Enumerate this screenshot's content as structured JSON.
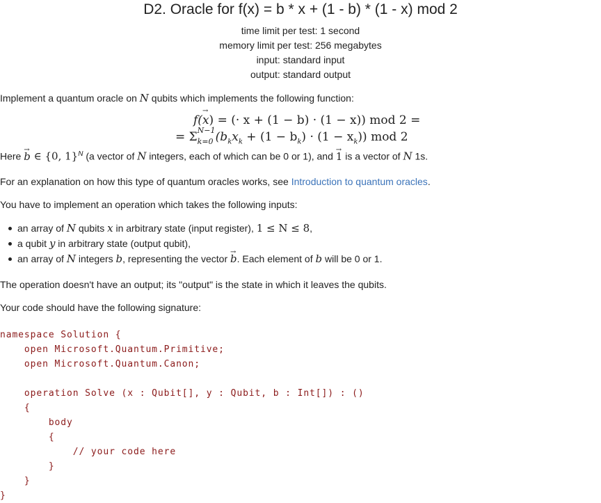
{
  "header": {
    "title": "D2. Oracle for f(x) = b * x + (1 - b) * (1 - x) mod 2",
    "time_limit": "time limit per test: 1 second",
    "memory_limit": "memory limit per test: 256 megabytes",
    "input": "input: standard input",
    "output": "output: standard output"
  },
  "statement": {
    "intro_before": "Implement a quantum oracle on ",
    "intro_N": "N",
    "intro_after": " qubits which implements the following function:",
    "eq_line1_a": "f(",
    "eq_line1_x": "x",
    "eq_line1_b": ") = (",
    "eq_line1_rest": "· x + (1 − b) · (1 − x))   mod 2 =",
    "eq_line2": "= Σ",
    "eq_line2_sup": "N−1",
    "eq_line2_sub": "k=0",
    "eq_line2_rest": "(b",
    "eq_line2_bk": "k",
    "eq_line2_x": "x",
    "eq_line2_xk": "k",
    "eq_line2_mid": " + (1 − b",
    "eq_line2_bk2": "k",
    "eq_line2_mid2": ") · (1 − x",
    "eq_line2_xk2": "k",
    "eq_line2_end": "))   mod 2",
    "here_prefix": "Here ",
    "here_b": "b",
    "here_set": " ∈ {0, 1}",
    "here_sup": "N",
    "here_text1": " (a vector of ",
    "here_N": "N",
    "here_text2": " integers, each of which can be 0 or 1), and ",
    "here_one": "1",
    "here_text3": " is a vector of ",
    "here_N2": "N",
    "here_text4": " 1s.",
    "explain_prefix": "For an explanation on how this type of quantum oracles works, see ",
    "explain_link": "Introduction to quantum oracles",
    "explain_suffix": ".",
    "inputs_intro": "You have to implement an operation which takes the following inputs:",
    "bullet1_a": "an array of ",
    "bullet1_N": "N",
    "bullet1_b": " qubits ",
    "bullet1_x": "x",
    "bullet1_c": " in arbitrary state (input register), ",
    "bullet1_range": "1 ≤ N ≤ 8",
    "bullet1_d": ",",
    "bullet2_a": "a qubit ",
    "bullet2_y": "y",
    "bullet2_b": " in arbitrary state (output qubit),",
    "bullet3_a": "an array of ",
    "bullet3_N": "N",
    "bullet3_b": " integers ",
    "bullet3_bvar": "b",
    "bullet3_c": ", representing the vector ",
    "bullet3_vec": "b",
    "bullet3_d": ". Each element of ",
    "bullet3_bvar2": "b",
    "bullet3_e": " will be 0 or 1.",
    "no_output": "The operation doesn't have an output; its \"output\" is the state in which it leaves the qubits.",
    "signature_intro": "Your code should have the following signature:"
  },
  "code": "namespace Solution {\n    open Microsoft.Quantum.Primitive;\n    open Microsoft.Quantum.Canon;\n\n    operation Solve (x : Qubit[], y : Qubit, b : Int[]) : ()\n    {\n        body\n        {\n            // your code here\n        }\n    }\n}"
}
